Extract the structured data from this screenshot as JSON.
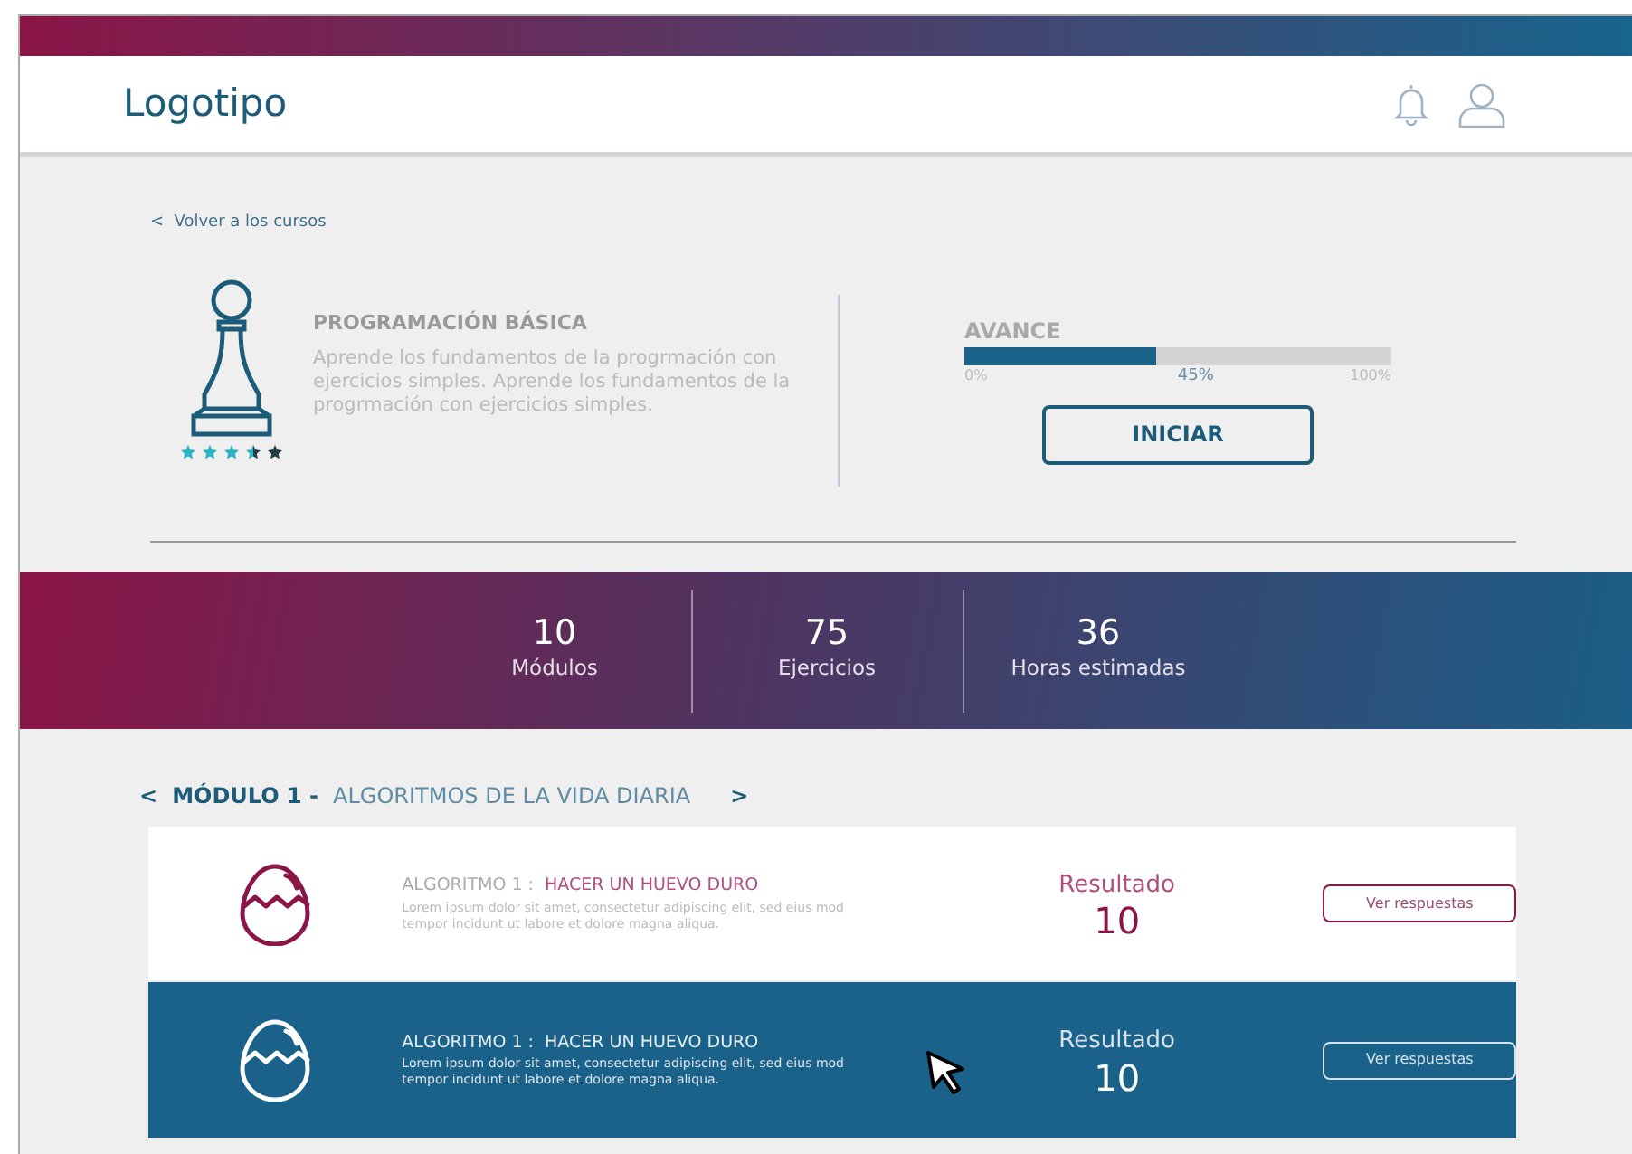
{
  "header": {
    "logo": "Logotipo"
  },
  "back_link": {
    "arrow": "<",
    "label": "Volver a los cursos"
  },
  "course": {
    "title": "PROGRAMACIÓN BÁSICA",
    "description": "Aprende los fundamentos de la progrmación con ejercicios simples. Aprende los fundamentos de la progrmación con ejercicios simples.",
    "stars": 3.5
  },
  "progress": {
    "label": "AVANCE",
    "level": 0.45,
    "min_label": "0%",
    "value_label": "45%",
    "max_label": "100%",
    "button": "INICIAR"
  },
  "stats": [
    {
      "value": "10",
      "label": "Módulos"
    },
    {
      "value": "75",
      "label": "Ejercicios"
    },
    {
      "value": "36",
      "label": "Horas estimadas"
    }
  ],
  "module": {
    "prev": "<",
    "number": "MÓDULO 1 -",
    "title": "ALGORITMOS DE LA VIDA DIARIA",
    "next": ">"
  },
  "exercises": [
    {
      "prefix": "ALGORITMO 1 :",
      "title": "HACER UN HUEVO DURO",
      "description": "Lorem ipsum dolor sit amet, consectetur adipiscing elit, sed eius mod tempor incidunt ut labore et dolore magna aliqua.",
      "result_label": "Resultado",
      "result": "10",
      "button": "Ver respuestas",
      "selected": false
    },
    {
      "prefix": "ALGORITMO 1 :",
      "title": "HACER UN HUEVO DURO",
      "description": "Lorem ipsum dolor sit amet, consectetur adipiscing elit, sed eius mod tempor incidunt ut labore et dolore magna aliqua.",
      "result_label": "Resultado",
      "result": "10",
      "button": "Ver respuestas",
      "selected": true
    }
  ]
}
